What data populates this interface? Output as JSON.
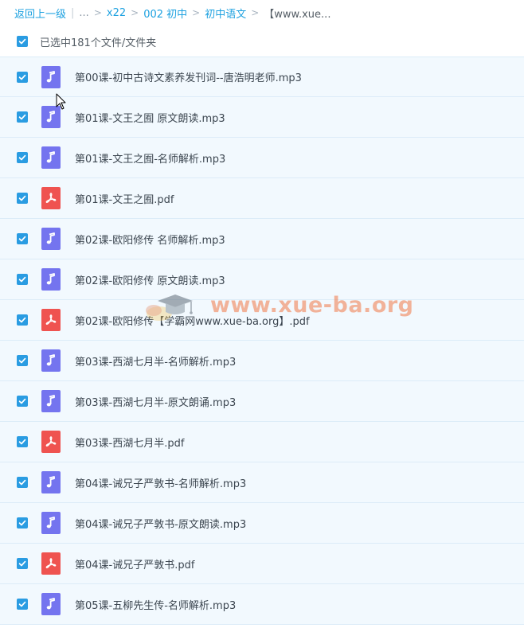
{
  "breadcrumb": {
    "back_label": "返回上一级",
    "ellipsis": "...",
    "items": [
      "x22",
      "002 初中",
      "初中语文"
    ],
    "current": "【www.xue..."
  },
  "selection": {
    "label": "已选中181个文件/文件夹",
    "all_selected": true
  },
  "files": [
    {
      "name": "第00课-初中古诗文素养发刊词--唐浩明老师.mp3",
      "type": "audio",
      "checked": true
    },
    {
      "name": "第01课-文王之囿 原文朗读.mp3",
      "type": "audio",
      "checked": true
    },
    {
      "name": "第01课-文王之囿-名师解析.mp3",
      "type": "audio",
      "checked": true
    },
    {
      "name": "第01课-文王之囿.pdf",
      "type": "pdf",
      "checked": true
    },
    {
      "name": "第02课-欧阳修传 名师解析.mp3",
      "type": "audio",
      "checked": true
    },
    {
      "name": "第02课-欧阳修传 原文朗读.mp3",
      "type": "audio",
      "checked": true
    },
    {
      "name": "第02课-欧阳修传【学霸网www.xue-ba.org】.pdf",
      "type": "pdf",
      "checked": true
    },
    {
      "name": "第03课-西湖七月半-名师解析.mp3",
      "type": "audio",
      "checked": true
    },
    {
      "name": "第03课-西湖七月半-原文朗诵.mp3",
      "type": "audio",
      "checked": true
    },
    {
      "name": "第03课-西湖七月半.pdf",
      "type": "pdf",
      "checked": true
    },
    {
      "name": "第04课-诫兄子严敦书-名师解析.mp3",
      "type": "audio",
      "checked": true
    },
    {
      "name": "第04课-诫兄子严敦书-原文朗读.mp3",
      "type": "audio",
      "checked": true
    },
    {
      "name": "第04课-诫兄子严敦书.pdf",
      "type": "pdf",
      "checked": true
    },
    {
      "name": "第05课-五柳先生传-名师解析.mp3",
      "type": "audio",
      "checked": true
    }
  ],
  "watermark": {
    "text": "www.xue-ba.org"
  },
  "icons": {
    "audio": "music-note-icon",
    "pdf": "pdf-icon",
    "checkbox": "checkmark-icon"
  },
  "colors": {
    "link": "#1da1e0",
    "checkbox": "#2a9ce2",
    "selected_row": "#f2f9fe",
    "audio_icon": "#7474ef",
    "pdf_icon": "#ef5350"
  }
}
